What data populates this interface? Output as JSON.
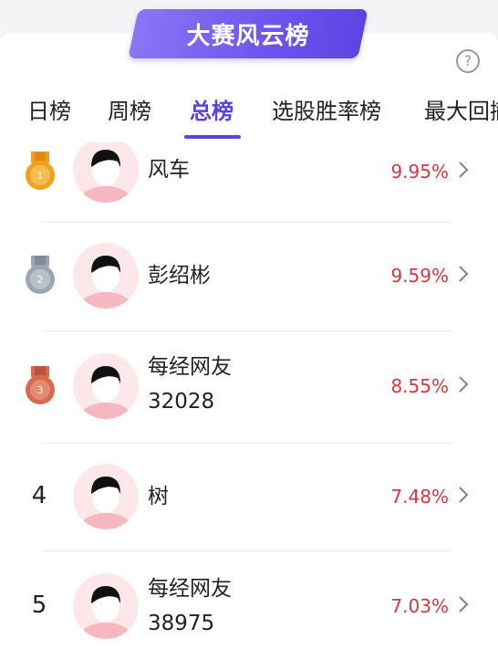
{
  "header": {
    "banner_title": "大赛风云榜",
    "help_symbol": "?"
  },
  "tabs": [
    {
      "label": "日榜",
      "active": false
    },
    {
      "label": "周榜",
      "active": false
    },
    {
      "label": "总榜",
      "active": true
    },
    {
      "label": "选股胜率榜",
      "active": false
    },
    {
      "label": "最大回撤",
      "active": false
    }
  ],
  "ranking": [
    {
      "rank": "1",
      "medal": "gold-medal-icon",
      "name_line1": "风车",
      "name_line2": "",
      "percent": "9.95%"
    },
    {
      "rank": "2",
      "medal": "silver-medal-icon",
      "name_line1": "彭绍彬",
      "name_line2": "",
      "percent": "9.59%"
    },
    {
      "rank": "3",
      "medal": "bronze-medal-icon",
      "name_line1": "每经网友",
      "name_line2": "32028",
      "percent": "8.55%"
    },
    {
      "rank": "4",
      "medal": "",
      "name_line1": "树",
      "name_line2": "",
      "percent": "7.48%"
    },
    {
      "rank": "5",
      "medal": "",
      "name_line1": "每经网友",
      "name_line2": "38975",
      "percent": "7.03%"
    }
  ],
  "colors": {
    "accent": "#5b42e0",
    "percent": "#d9363e",
    "gold": "#f0a21c",
    "silver": "#9aa6b4",
    "bronze": "#d46a4f"
  }
}
